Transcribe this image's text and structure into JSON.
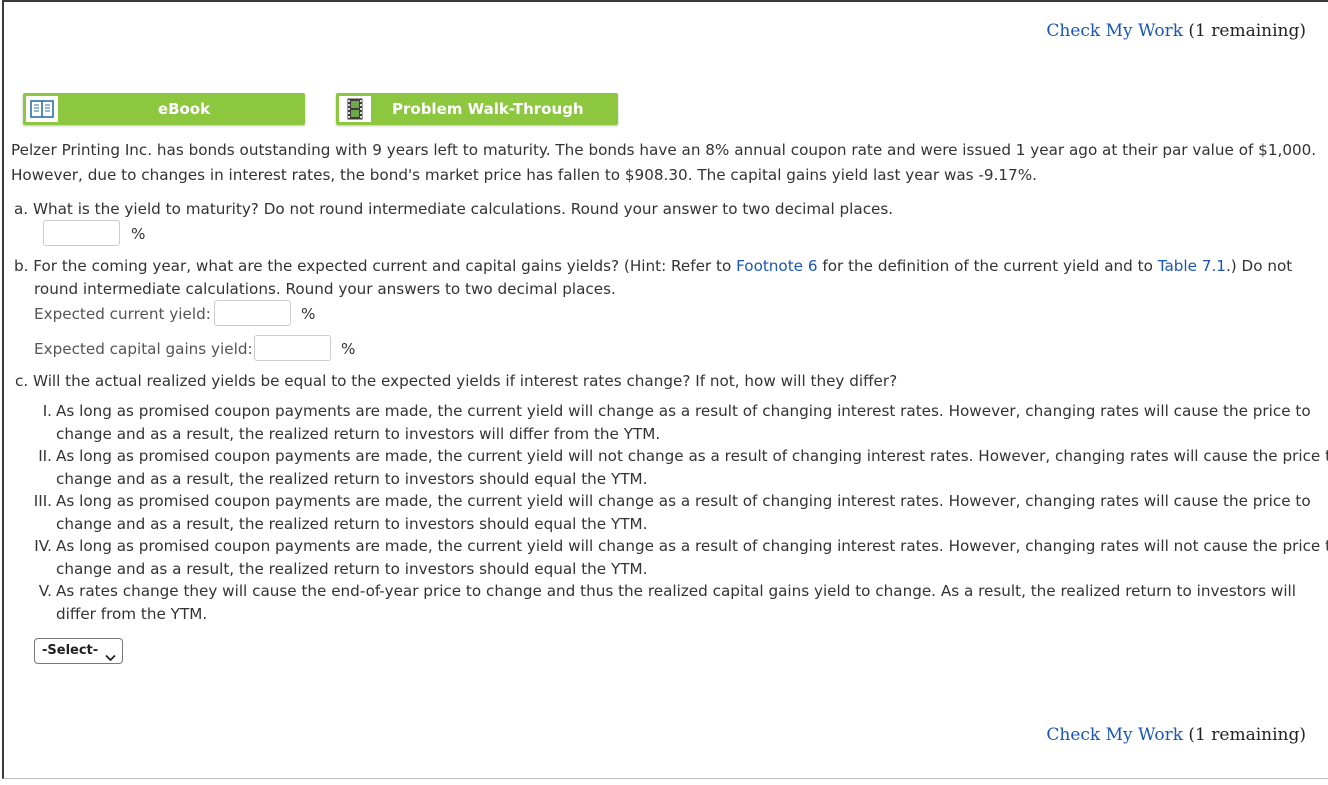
{
  "check_work": {
    "link_label": "Check My Work",
    "remaining": "(1 remaining)"
  },
  "buttons": {
    "ebook": "eBook",
    "walkthrough": "Problem Walk-Through"
  },
  "intro": {
    "line1": "Pelzer Printing Inc. has bonds outstanding with 9 years left to maturity. The bonds have an 8% annual coupon rate and were issued 1 year ago at their par value of $1,000.",
    "line2": "However, due to changes in interest rates, the bond's market price has fallen to $908.30. The capital gains yield last year was -9.17%."
  },
  "question_a": {
    "text": "a. What is the yield to maturity? Do not round intermediate calculations. Round your answer to two decimal places.",
    "unit": "%",
    "value": ""
  },
  "question_b": {
    "text_pre": "b. For the coming year, what are the expected current and capital gains yields? (Hint: Refer to ",
    "link1": "Footnote 6",
    "text_mid": " for the definition of the current yield and to ",
    "link2": "Table 7.1",
    "text_post": ".) Do not",
    "line2": "round intermediate calculations. Round your answers to two decimal places.",
    "current_label": "Expected current yield:",
    "capital_label": "Expected capital gains yield:",
    "unit": "%",
    "current_value": "",
    "capital_value": ""
  },
  "question_c": {
    "text": "c. Will the actual realized yields be equal to the expected yields if interest rates change? If not, how will they differ?",
    "options": [
      {
        "num": "I.",
        "l1": "As long as promised coupon payments are made, the current yield will change as a result of changing interest rates. However, changing rates will cause the price to",
        "l2": "change and as a result, the realized return to investors will differ from the YTM."
      },
      {
        "num": "II.",
        "l1": "As long as promised coupon payments are made, the current yield will not change as a result of changing interest rates. However, changing rates will cause the price to",
        "l2": "change and as a result, the realized return to investors should equal the YTM."
      },
      {
        "num": "III.",
        "l1": "As long as promised coupon payments are made, the current yield will change as a result of changing interest rates. However, changing rates will cause the price to",
        "l2": "change and as a result, the realized return to investors should equal the YTM."
      },
      {
        "num": "IV.",
        "l1": "As long as promised coupon payments are made, the current yield will change as a result of changing interest rates. However, changing rates will not cause the price to",
        "l2": "change and as a result, the realized return to investors should equal the YTM."
      },
      {
        "num": "V.",
        "l1": "As rates change they will cause the end-of-year price to change and thus the realized capital gains yield to change. As a result, the realized return to investors will",
        "l2": "differ from the YTM."
      }
    ],
    "select_value": "-Select-"
  }
}
